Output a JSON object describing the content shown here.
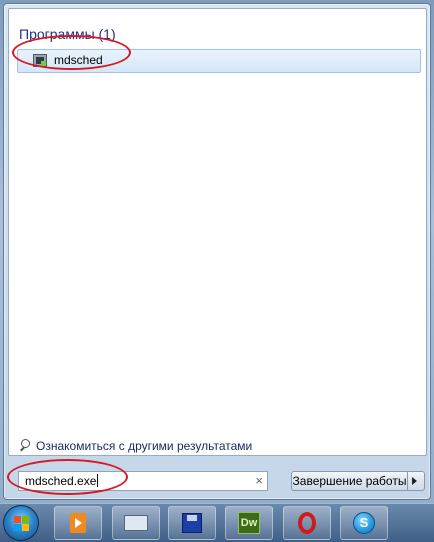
{
  "start_menu": {
    "results_group_title": "Программы (1)",
    "results": [
      {
        "label": "mdsched",
        "icon": "memory-diagnostic-icon"
      }
    ],
    "more_results_link": "Ознакомиться с другими результатами",
    "search": {
      "value": "mdsched.exe",
      "clear_glyph": "×"
    },
    "shutdown_button": "Завершение работы"
  },
  "taskbar": {
    "pinned": [
      {
        "name": "windows-media-player-icon"
      },
      {
        "name": "on-screen-keyboard-icon"
      },
      {
        "name": "floppy-save-icon"
      },
      {
        "name": "dreamweaver-icon",
        "text": "Dw"
      },
      {
        "name": "opera-icon"
      },
      {
        "name": "skype-icon",
        "text": "S"
      }
    ]
  },
  "annotations": {
    "highlight_color": "#d21b23"
  },
  "colors": {
    "header_text": "#1e3287",
    "selected_item_bg": "#d4e6f8",
    "taskbar": "#3f5f86"
  }
}
